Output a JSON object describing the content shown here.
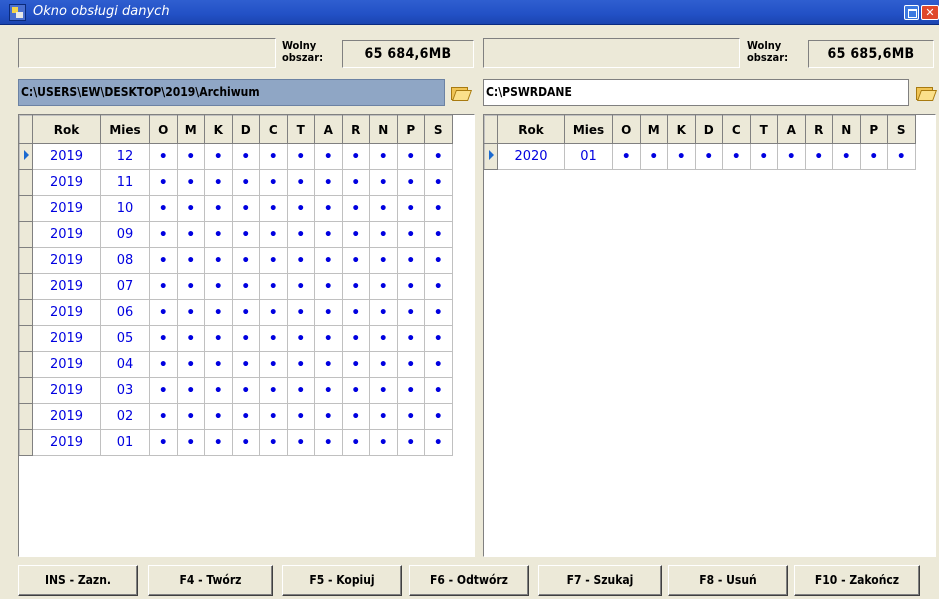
{
  "window": {
    "title": "Okno obsługi danych"
  },
  "left": {
    "free_label_1": "Wolny",
    "free_label_2": "obszar:",
    "free_space": "65 684,6MB",
    "path": "C:\\USERS\\EW\\DESKTOP\\2019\\Archiwum",
    "columns": [
      "Rok",
      "Mies",
      "O",
      "M",
      "K",
      "D",
      "C",
      "T",
      "A",
      "R",
      "N",
      "P",
      "S"
    ],
    "rows": [
      {
        "rok": "2019",
        "mies": "12"
      },
      {
        "rok": "2019",
        "mies": "11"
      },
      {
        "rok": "2019",
        "mies": "10"
      },
      {
        "rok": "2019",
        "mies": "09"
      },
      {
        "rok": "2019",
        "mies": "08"
      },
      {
        "rok": "2019",
        "mies": "07"
      },
      {
        "rok": "2019",
        "mies": "06"
      },
      {
        "rok": "2019",
        "mies": "05"
      },
      {
        "rok": "2019",
        "mies": "04"
      },
      {
        "rok": "2019",
        "mies": "03"
      },
      {
        "rok": "2019",
        "mies": "02"
      },
      {
        "rok": "2019",
        "mies": "01"
      }
    ]
  },
  "right": {
    "free_label_1": "Wolny",
    "free_label_2": "obszar:",
    "free_space": "65 685,6MB",
    "path": "C:\\PSWRDANE",
    "columns": [
      "Rok",
      "Mies",
      "O",
      "M",
      "K",
      "D",
      "C",
      "T",
      "A",
      "R",
      "N",
      "P",
      "S"
    ],
    "rows": [
      {
        "rok": "2020",
        "mies": "01"
      }
    ]
  },
  "flag_mark": "•",
  "buttons": [
    {
      "id": "ins",
      "label": "INS - Zazn."
    },
    {
      "id": "f4",
      "label": "F4 - Twórz"
    },
    {
      "id": "f5",
      "label": "F5 - Kopiuj"
    },
    {
      "id": "f6",
      "label": "F6 - Odtwórz"
    },
    {
      "id": "f7",
      "label": "F7 - Szukaj"
    },
    {
      "id": "f8",
      "label": "F8 - Usuń"
    },
    {
      "id": "f10",
      "label": "F10 - Zakończ"
    }
  ]
}
